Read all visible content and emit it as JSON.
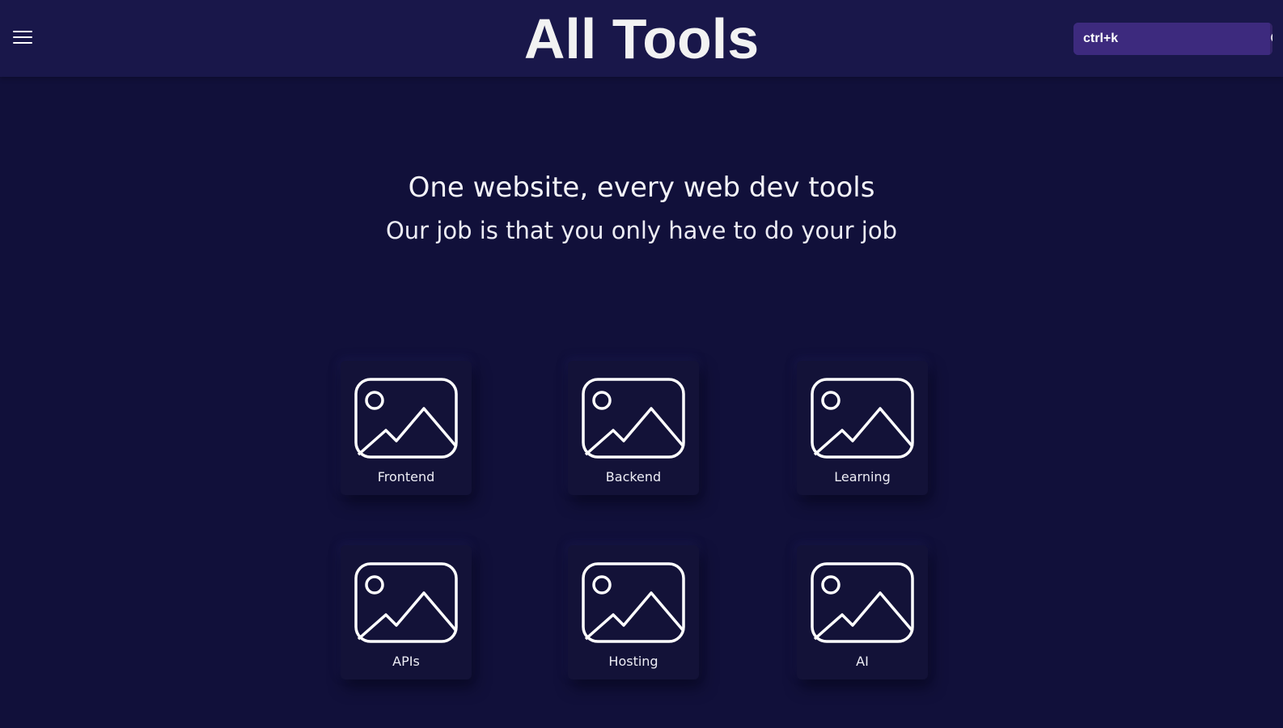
{
  "header": {
    "title": "All Tools",
    "menu_icon": "hamburger-menu-icon",
    "search": {
      "placeholder": "ctrl+k",
      "value": "",
      "icon": "search-icon"
    }
  },
  "hero": {
    "headline": "One website, every web dev tools",
    "subheadline": "Our job is that you only have to do your job"
  },
  "categories": [
    {
      "label": "Frontend",
      "icon": "image-placeholder-icon"
    },
    {
      "label": "Backend",
      "icon": "image-placeholder-icon"
    },
    {
      "label": "Learning",
      "icon": "image-placeholder-icon"
    },
    {
      "label": "APIs",
      "icon": "image-placeholder-icon"
    },
    {
      "label": "Hosting",
      "icon": "image-placeholder-icon"
    },
    {
      "label": "AI",
      "icon": "image-placeholder-icon"
    }
  ],
  "colors": {
    "background": "#11103a",
    "header": "#19174a",
    "search_accent": "#3d2a7e",
    "card": "#131238",
    "text": "#f1f1f6"
  }
}
